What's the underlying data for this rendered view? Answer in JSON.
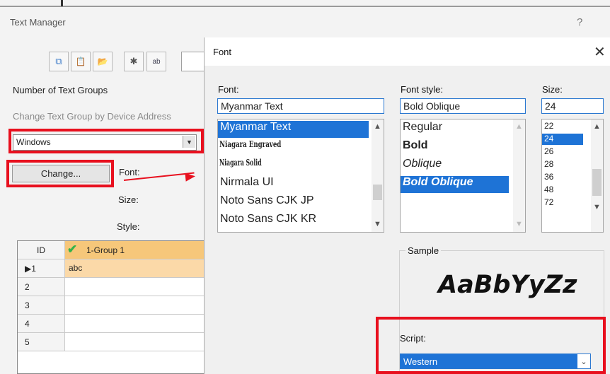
{
  "text_manager": {
    "title": "Text Manager",
    "help_glyph": "?",
    "toolbar_icons": [
      "copy-icon",
      "paste-icon",
      "folder-icon",
      "import-icon",
      "text-replace-icon"
    ],
    "toolbar_icon_glyphs": [
      "⧉",
      "📋",
      "📂",
      "✱",
      "ab"
    ],
    "number_of_groups_label": "Number of Text Groups",
    "change_by_address_label": "Change Text Group by Device Address",
    "font_source_value": "Windows",
    "change_button_label": "Change...",
    "font_label": "Font:",
    "size_label": "Size:",
    "style_label": "Style:",
    "grid": {
      "id_header": "ID",
      "group_header": "1-Group 1",
      "rows": [
        {
          "id": "▶1",
          "value": "abc"
        },
        {
          "id": "2",
          "value": ""
        },
        {
          "id": "3",
          "value": ""
        },
        {
          "id": "4",
          "value": ""
        },
        {
          "id": "5",
          "value": ""
        }
      ]
    },
    "highlight_color": "#e8101e"
  },
  "font_dialog": {
    "title": "Font",
    "close_glyph": "✕",
    "font_label": "Font:",
    "font_value": "Myanmar Text",
    "font_list": [
      "Myanmar Text",
      "Niagara Engraved",
      "Niagara Solid",
      "Nirmala UI",
      "Noto Sans CJK JP",
      "Noto Sans CJK KR"
    ],
    "font_selected_index": 0,
    "style_label": "Font style:",
    "style_value": "Bold Oblique",
    "style_list": [
      "Regular",
      "Bold",
      "Oblique",
      "Bold Oblique"
    ],
    "style_selected_index": 3,
    "size_label": "Size:",
    "size_value": "24",
    "size_list": [
      "22",
      "24",
      "26",
      "28",
      "36",
      "48",
      "72"
    ],
    "size_selected_index": 1,
    "sample_label": "Sample",
    "sample_text": "AaBbYyZz",
    "script_label": "Script:",
    "script_value": "Western",
    "accent_color": "#1e73d6"
  }
}
